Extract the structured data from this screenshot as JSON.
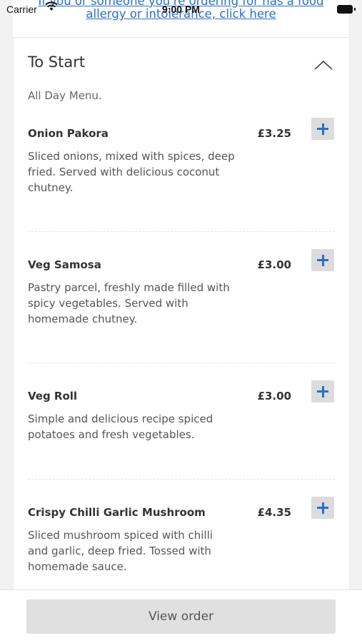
{
  "status_bar": {
    "carrier": "Carrier",
    "time": "9:00 PM"
  },
  "allergy_notice": {
    "line1": "If you or someone you're ordering for has a food",
    "line2": "allergy or intolerance, click here"
  },
  "section": {
    "title": "To Start",
    "subtitle": "All Day Menu.",
    "collapse_icon": "chevron-up-icon"
  },
  "items": [
    {
      "name": "Onion Pakora",
      "price": "£3.25",
      "description": "Sliced onions, mixed with spices, deep fried. Served with delicious coconut chutney."
    },
    {
      "name": "Veg Samosa",
      "price": "£3.00",
      "description": "Pastry parcel, freshly made filled with spicy vegetables. Served with homemade chutney."
    },
    {
      "name": "Veg Roll",
      "price": "£3.00",
      "description": "Simple and delicious recipe spiced potatoes and fresh vegetables."
    },
    {
      "name": "Crispy Chilli Garlic Mushroom",
      "price": "£4.35",
      "description": "Sliced mushroom spiced with chilli and garlic, deep fried. Tossed with homemade sauce."
    }
  ],
  "add_icon": "plus-icon",
  "footer": {
    "view_order_label": "View order"
  },
  "colors": {
    "accent": "#2a6fc9",
    "button_bg": "#dcdcdc",
    "view_order_bg": "#e0e0e0"
  }
}
